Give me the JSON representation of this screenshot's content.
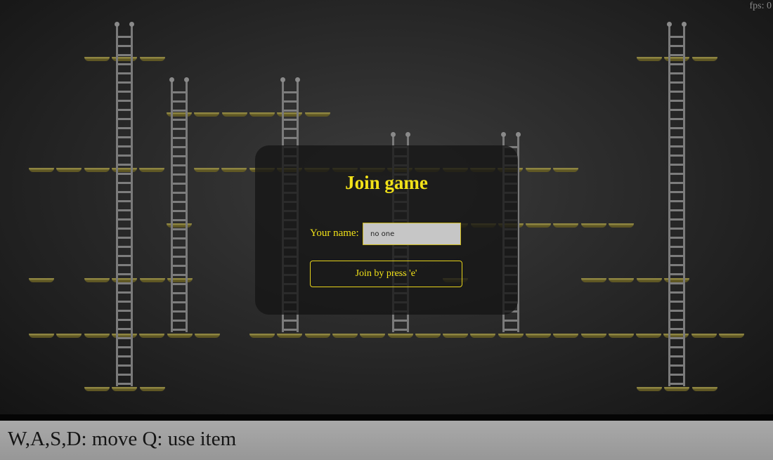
{
  "hud": {
    "fps": "fps: 0"
  },
  "join_dialog": {
    "title": "Join game",
    "name_label": "Your name:",
    "name_value": "no one",
    "join_button": "Join by press 'e'"
  },
  "controls": {
    "text": "W,A,S,D: move Q: use item"
  },
  "colors": {
    "accent_yellow": "#f2e218",
    "platform": "#8e8541",
    "ladder": "#7a7a7a",
    "background": "#2a2a2a"
  }
}
